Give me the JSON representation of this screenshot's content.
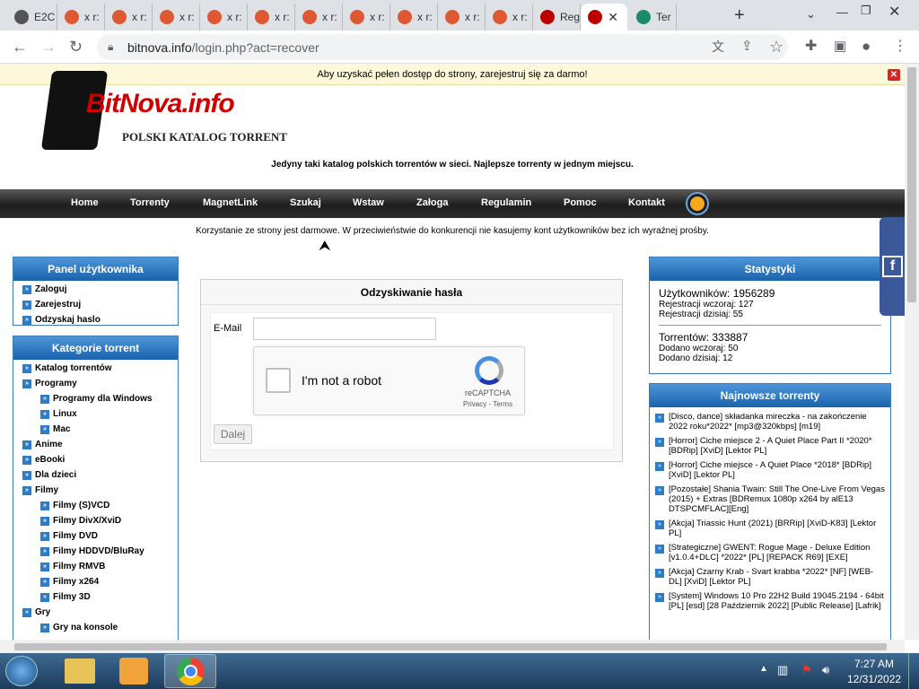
{
  "browser": {
    "tabs": [
      {
        "label": "E2C",
        "icon": "globe-icon"
      },
      {
        "label": "x r:",
        "icon": "duckduckgo-icon"
      },
      {
        "label": "x r:",
        "icon": "duckduckgo-icon"
      },
      {
        "label": "x r:",
        "icon": "duckduckgo-icon"
      },
      {
        "label": "x r:",
        "icon": "duckduckgo-icon"
      },
      {
        "label": "x r:",
        "icon": "duckduckgo-icon"
      },
      {
        "label": "x r:",
        "icon": "duckduckgo-icon"
      },
      {
        "label": "x r:",
        "icon": "duckduckgo-icon"
      },
      {
        "label": "x r:",
        "icon": "duckduckgo-icon"
      },
      {
        "label": "x r:",
        "icon": "duckduckgo-icon"
      },
      {
        "label": "x r:",
        "icon": "duckduckgo-icon"
      },
      {
        "label": "Reg",
        "icon": "bitnova-icon"
      },
      {
        "label": "",
        "icon": "bitnova-icon",
        "active": true
      },
      {
        "label": "Ter",
        "icon": "site-icon"
      }
    ],
    "url_host": "bitnova.info",
    "url_path": "/login.php?act=recover"
  },
  "page": {
    "notice": "Aby uzyskać pełen dostęp do strony, zarejestruj się za darmo!",
    "notice_close": "✕",
    "logo_text": "BitNova.info",
    "logo_sub": "POLSKI KATALOG TORRENT",
    "slogan": "Jedyny taki katalog polskich torrentów w sieci. Najlepsze torrenty w jednym miejscu.",
    "nav": [
      "Home",
      "Torrenty",
      "MagnetLink",
      "Szukaj",
      "Wstaw",
      "Załoga",
      "Regulamin",
      "Pomoc",
      "Kontakt"
    ],
    "info": "Korzystanie ze strony jest darmowe. W przeciwieństwie do konkurencji nie kasujemy kont użytkowników bez ich wyraźnej prośby.",
    "user_panel": {
      "title": "Panel użytkownika",
      "items": [
        "Zaloguj",
        "Zarejestruj",
        "Odzyskaj haslo"
      ]
    },
    "categories": {
      "title": "Kategorie torrent",
      "items": [
        {
          "label": "Katalog torrentów",
          "sub": false
        },
        {
          "label": "Programy",
          "sub": false
        },
        {
          "label": "Programy dla Windows",
          "sub": true
        },
        {
          "label": "Linux",
          "sub": true
        },
        {
          "label": "Mac",
          "sub": true
        },
        {
          "label": "Anime",
          "sub": false
        },
        {
          "label": "eBooki",
          "sub": false
        },
        {
          "label": "Dla dzieci",
          "sub": false
        },
        {
          "label": "Filmy",
          "sub": false
        },
        {
          "label": "Filmy (S)VCD",
          "sub": true
        },
        {
          "label": "Filmy DivX/XviD",
          "sub": true
        },
        {
          "label": "Filmy DVD",
          "sub": true
        },
        {
          "label": "Filmy HDDVD/BluRay",
          "sub": true
        },
        {
          "label": "Filmy RMVB",
          "sub": true
        },
        {
          "label": "Filmy x264",
          "sub": true
        },
        {
          "label": "Filmy 3D",
          "sub": true
        },
        {
          "label": "Gry",
          "sub": false
        },
        {
          "label": "Gry na konsole",
          "sub": true
        }
      ]
    },
    "recover_form": {
      "title": "Odzyskiwanie hasła",
      "email_label": "E-Mail",
      "email_value": "",
      "captcha_label": "I'm not a robot",
      "captcha_brand": "reCAPTCHA",
      "captcha_links": "Privacy - Terms",
      "submit_label": "Dalej"
    },
    "stats": {
      "title": "Statystyki",
      "users": "Użytkowników: 1956289",
      "reg_yesterday": "Rejestracji wczoraj: 127",
      "reg_today": "Rejestracji dzisiaj: 55",
      "torrents": "Torrentów: 333887",
      "added_yesterday": "Dodano wczoraj: 50",
      "added_today": "Dodano dzisiaj: 12"
    },
    "newest": {
      "title": "Najnowsze torrenty",
      "items": [
        "[Disco, dance] składanka mireczka - na zakończenie 2022 roku*2022* [mp3@320kbps] [m19]",
        "[Horror] Ciche miejsce 2 - A Quiet Place Part II *2020* [BDRip] [XviD] [Lektor PL]",
        "[Horror] Ciche miejsce - A Quiet Place *2018* [BDRip] [XviD] [Lektor PL]",
        "[Pozostałe] Shania Twain: Still The One-Live From Vegas (2015) + Extras [BDRemux 1080p x264 by alE13 DTSPCMFLAC][Eng]",
        "[Akcja] Triassic Hunt (2021) [BRRip] [XviD-K83] [Lektor PL]",
        "[Strategiczne] GWENT: Rogue Mage - Deluxe Edition [v1.0.4+DLC] *2022* [PL] [REPACK R69] [EXE]",
        "[Akcja] Czarny Krab - Svart krabba *2022* [NF] [WEB-DL] [XviD] [Lektor PL]",
        "[System] Windows 10 Pro 22H2 Build 19045.2194 - 64bit [PL] [esd] [28 Październik 2022] [Public Release] [Lafrik]"
      ]
    }
  },
  "taskbar": {
    "time": "7:27 AM",
    "date": "12/31/2022"
  },
  "colors": {
    "accent": "#1a63ad",
    "nav": "#2b2b2b",
    "notice": "#fdf8d9"
  }
}
